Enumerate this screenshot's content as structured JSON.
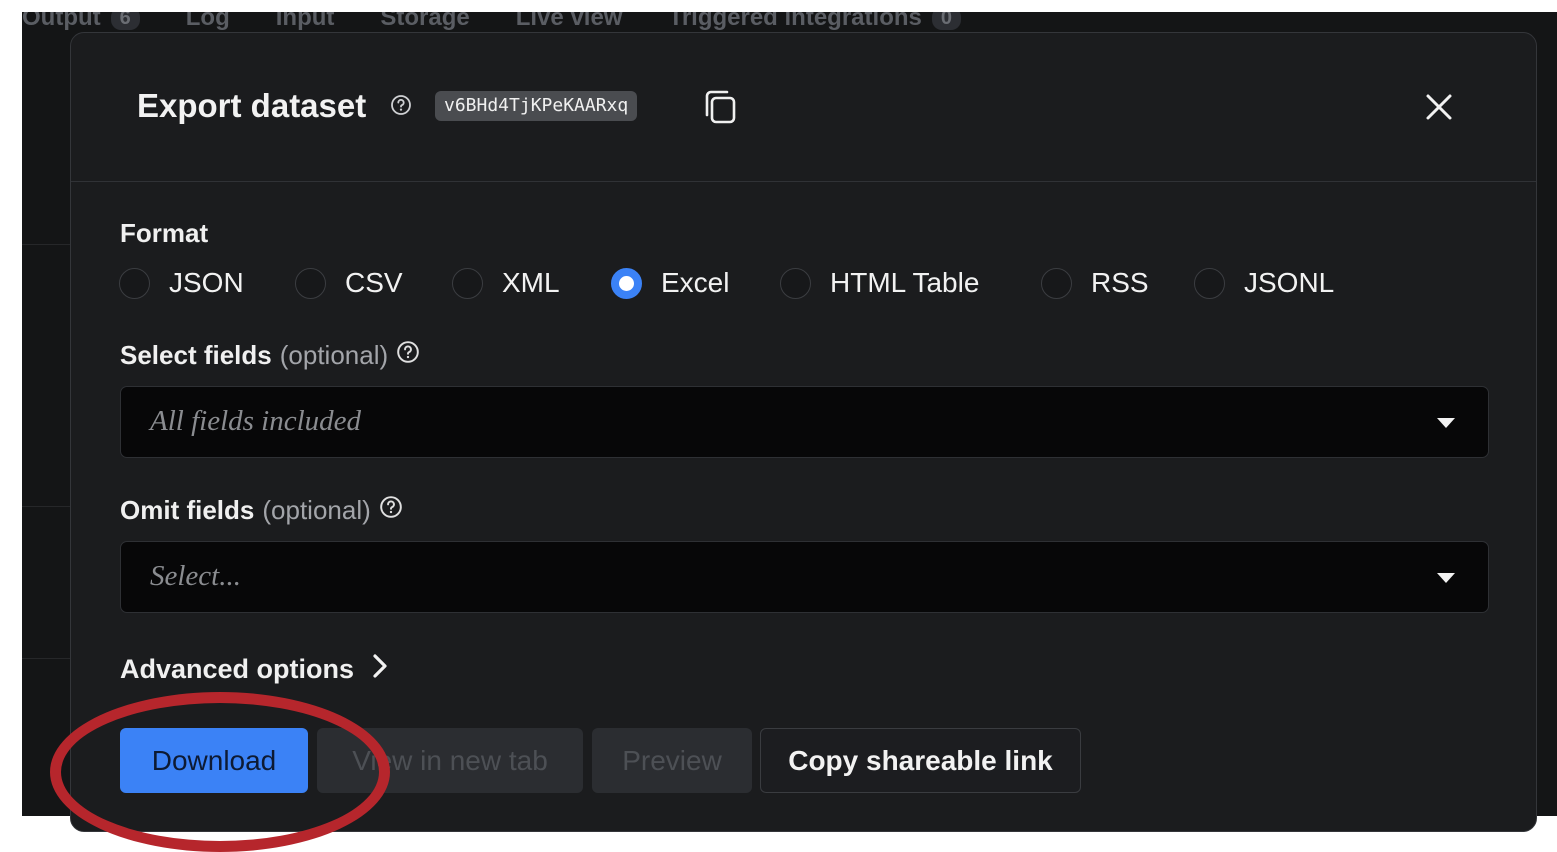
{
  "background": {
    "tabs": [
      {
        "label": "Output",
        "badge": "6"
      },
      {
        "label": "Log"
      },
      {
        "label": "Input"
      },
      {
        "label": "Storage"
      },
      {
        "label": "Live view"
      },
      {
        "label": "Triggered integrations",
        "badge": "0"
      }
    ]
  },
  "modal": {
    "title": "Export dataset",
    "dataset_id": "v6BHd4TjKPeKAARxq",
    "format": {
      "label": "Format",
      "selected": "Excel",
      "options": [
        "JSON",
        "CSV",
        "XML",
        "Excel",
        "HTML Table",
        "RSS",
        "JSONL"
      ]
    },
    "select_fields": {
      "label": "Select fields",
      "optional": "(optional)",
      "placeholder": "All fields included"
    },
    "omit_fields": {
      "label": "Omit fields",
      "optional": "(optional)",
      "placeholder": "Select..."
    },
    "advanced_options": "Advanced options",
    "buttons": {
      "download": "Download",
      "view_new_tab": "View in new tab",
      "preview": "Preview",
      "copy_link": "Copy shareable link"
    }
  },
  "colors": {
    "accent": "#3b82f6",
    "annotation": "#b6262c",
    "modal_bg": "#1b1c1e"
  }
}
